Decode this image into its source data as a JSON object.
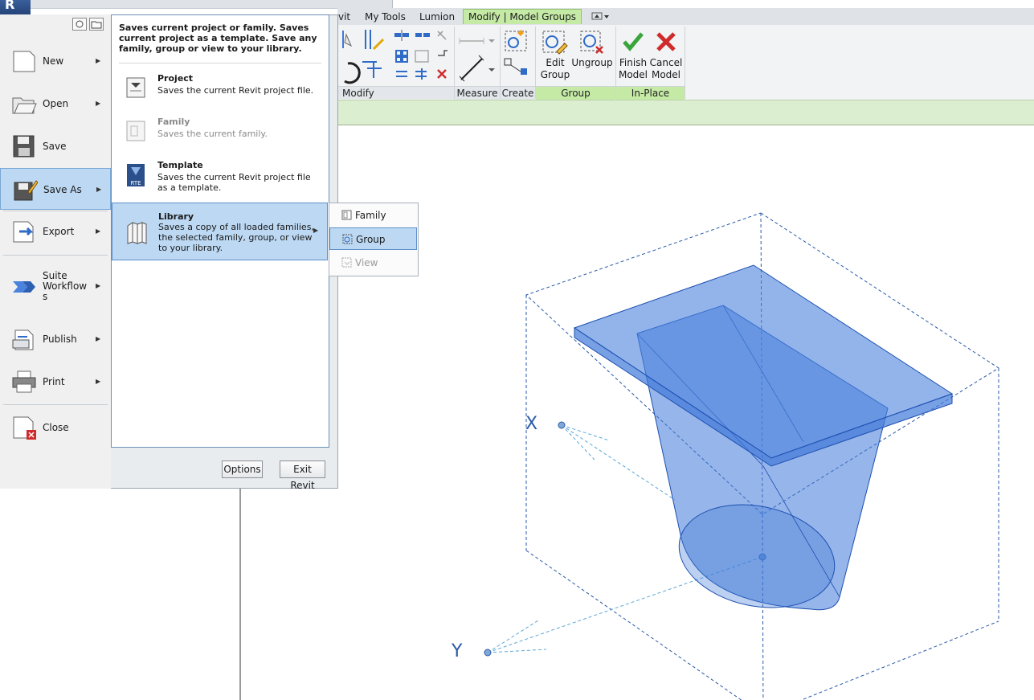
{
  "app": {
    "logo_letter": "R"
  },
  "tabs": [
    {
      "label": "vit"
    },
    {
      "label": "My Tools"
    },
    {
      "label": "Lumion"
    },
    {
      "label": "Modify | Model Groups"
    }
  ],
  "ribbon": {
    "panels": [
      {
        "label": "Modify"
      },
      {
        "label": "Measure"
      },
      {
        "label": "Create"
      },
      {
        "label": "Group"
      },
      {
        "label": "In-Place Editor"
      }
    ],
    "buttons": {
      "edit_group": "Edit\nGroup",
      "ungroup": "Ungroup",
      "finish_model": "Finish\nModel",
      "cancel_model": "Cancel\nModel"
    }
  },
  "app_menu": {
    "items": [
      {
        "label": "New",
        "icon": "new-document-icon",
        "has_submenu": true
      },
      {
        "label": "Open",
        "icon": "folder-open-icon",
        "has_submenu": true
      },
      {
        "label": "Save",
        "icon": "floppy-disk-icon",
        "has_submenu": false
      },
      {
        "label": "Save As",
        "icon": "save-as-icon",
        "has_submenu": true,
        "highlighted": true
      },
      {
        "label": "Export",
        "icon": "export-icon",
        "has_submenu": true
      },
      {
        "label": "Suite\nWorkflow\ns",
        "icon": "suite-workflows-icon",
        "has_submenu": true
      },
      {
        "label": "Publish",
        "icon": "publish-icon",
        "has_submenu": true
      },
      {
        "label": "Print",
        "icon": "printer-icon",
        "has_submenu": true
      },
      {
        "label": "Close",
        "icon": "close-document-icon",
        "has_submenu": false
      }
    ],
    "save_as_panel": {
      "header": "Saves current project or family. Saves current project as a template. Save any family, group or view to your library.",
      "options": [
        {
          "title": "Project",
          "desc": "Saves the current Revit project file.",
          "icon": "project-file-icon",
          "enabled": true
        },
        {
          "title": "Family",
          "desc": "Saves the current family.",
          "icon": "family-file-icon",
          "enabled": false
        },
        {
          "title": "Template",
          "desc": "Saves the current Revit project file as a template.",
          "icon": "template-rte-icon",
          "icon_text": "RTE",
          "enabled": true
        },
        {
          "title": "Library",
          "desc": "Saves a copy of all loaded families, the selected family, group, or view to your library.",
          "icon": "library-books-icon",
          "enabled": true,
          "highlighted": true
        }
      ]
    },
    "library_submenu": [
      {
        "label": "Family",
        "icon": "family-icon",
        "enabled": true
      },
      {
        "label": "Group",
        "icon": "group-icon",
        "enabled": true,
        "highlighted": true
      },
      {
        "label": "View",
        "icon": "view-icon",
        "enabled": false
      }
    ],
    "bottom_buttons": {
      "options": "Options",
      "exit": "Exit Revit"
    }
  },
  "view": {
    "axis_x": "X",
    "axis_y": "Y",
    "model_color": "#3f78d8",
    "accent": "#2a5aa8"
  },
  "colors": {
    "tab_active": "#c5eaa6",
    "menu_highlight": "#bcd8f2",
    "ribbon_context": "#dbeecf"
  }
}
